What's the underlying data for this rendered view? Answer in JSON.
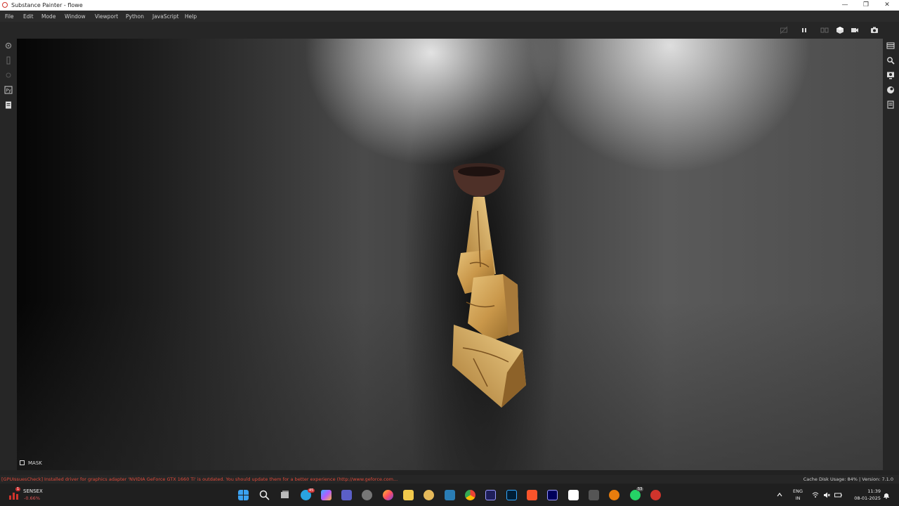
{
  "window": {
    "title": "Substance Painter - flowe",
    "controls": [
      "—",
      "❐",
      "✕"
    ]
  },
  "menu": {
    "items": [
      "File",
      "Edit",
      "Mode",
      "Window",
      "Viewport",
      "Python",
      "JavaScript",
      "Help"
    ]
  },
  "toolbar": {
    "icons": [
      "no-camera-icon",
      "pause-icon",
      "split-view-icon",
      "cube-view-icon",
      "camera-icon",
      "screenshot-icon"
    ]
  },
  "left_tools": [
    "settings-icon",
    "brush-icon",
    "bake-icon",
    "python-icon",
    "clipboard-icon"
  ],
  "right_tools": [
    "layers-icon",
    "search-icon",
    "display-icon",
    "material-icon",
    "shelf-icon"
  ],
  "viewport": {
    "mask_label": "MASK"
  },
  "status": {
    "warning": "[GPUIssuesCheck] Installed driver for graphics adapter 'NVIDIA GeForce GTX 1660 Ti' is outdated. You should update them for a better experience (http://www.geforce.com...",
    "cache": "Cache Disk Usage:   84% | Version: 7.1.0"
  },
  "taskbar": {
    "stock_name": "SENSEX",
    "stock_change": "-0.66%",
    "stock_badge": "1",
    "telegram_badge": "45",
    "whatsapp_badge": "53",
    "lang_line1": "ENG",
    "lang_line2": "IN",
    "time": "11:39",
    "date": "08-01-2025",
    "pinned": [
      "start",
      "search",
      "task-view",
      "telegram",
      "copilot",
      "teams",
      "settings",
      "firefox",
      "file-explorer",
      "blender-alt",
      "mirror",
      "chrome",
      "after-effects",
      "photoshop",
      "brave",
      "premiere",
      "capcut",
      "unity",
      "blender",
      "whatsapp",
      "substance-painter"
    ]
  },
  "colors": {
    "warning": "#e04a3a",
    "accent_red": "#d0342c"
  }
}
